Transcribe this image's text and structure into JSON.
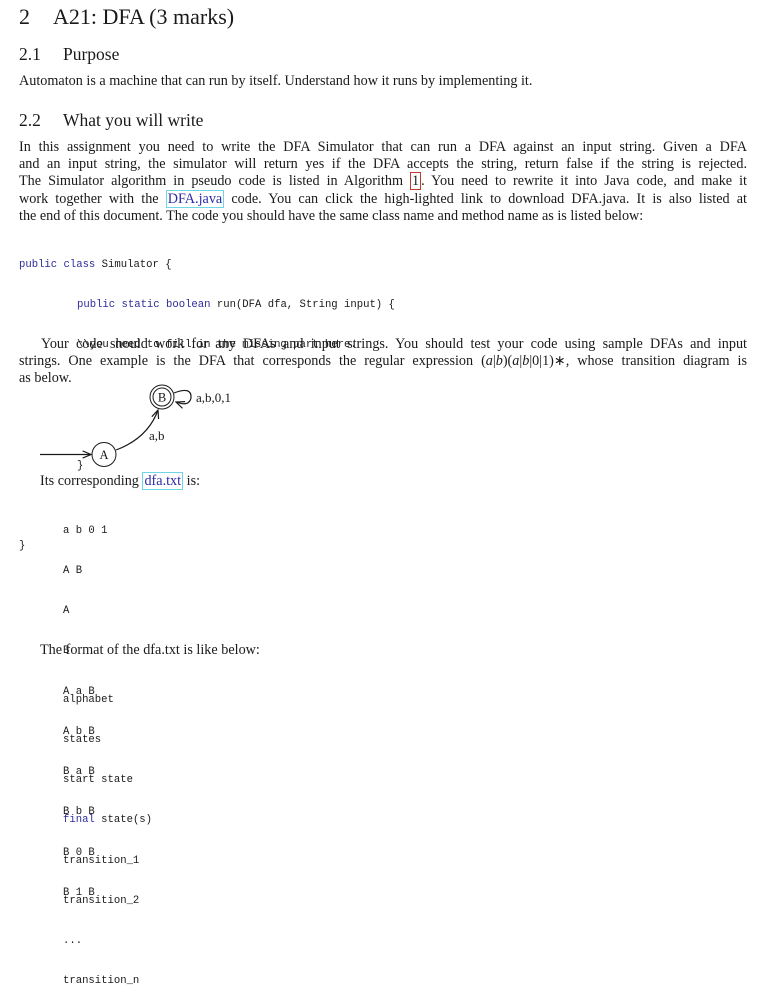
{
  "section": {
    "number": "2",
    "title": "A21: DFA (3 marks)"
  },
  "subsections": [
    {
      "number": "2.1",
      "title": "Purpose",
      "text": "Automaton is a machine that can run by itself. Understand how it runs by implementing it."
    },
    {
      "number": "2.2",
      "title": "What you will write"
    }
  ],
  "intro_paragraph": {
    "line1": "In this assignment you need to write the DFA Simulator that can run a DFA against an input string. Given a DFA",
    "line2": "and an input string, the simulator will return yes if the DFA accepts the string, return false if the string is rejected.",
    "line3_before": "The Simulator algorithm in pseudo code is listed in Algorithm ",
    "algorithm_ref": "1",
    "line3_after": ". You need to rewrite it into Java code, and make it",
    "line4_before": "work together with the ",
    "dfa_java_link": "DFA.java",
    "line4_after": " code. You can click the high-lighted link to download DFA.java. It is also listed at",
    "line5": "the end of this document. The code you should have the same class name and method name as is listed below:"
  },
  "code_listing": {
    "line1_kw": "public class",
    "line1_rest": " Simulator {",
    "line2_kw": "public static boolean",
    "line2_rest": " run(DFA dfa, String input) {",
    "line3": "\\\\you need to fill in the missing part here.",
    "line4": "}",
    "line5": "}"
  },
  "example_paragraph": {
    "line1": "Your code should work for any DFAs and input strings. You should test your code using sample DFAs and input",
    "line2_before": "strings. One example is the DFA that corresponds the regular expression (",
    "regex_parts": [
      "a",
      "|",
      "b",
      ")(",
      "a",
      "|",
      "b",
      "|0|1)∗, whose transition diagram is"
    ],
    "line3": "as below."
  },
  "diagram": {
    "states": [
      {
        "name": "A",
        "start": true,
        "final": false
      },
      {
        "name": "B",
        "start": false,
        "final": true
      }
    ],
    "transitions": [
      {
        "from": "A",
        "to": "B",
        "label": "a,b"
      },
      {
        "from": "B",
        "to": "B",
        "label": "a,b,0,1"
      }
    ]
  },
  "dfa_txt_intro": {
    "before": "Its corresponding ",
    "link": "dfa.txt",
    "after": " is:"
  },
  "dfa_txt_lines": [
    "a b 0 1",
    "A B",
    "A",
    "B",
    "A a B",
    "A b B",
    "B a B",
    "B b B",
    "B 0 B",
    "B 1 B"
  ],
  "format_intro": "The format of the dfa.txt is like below:",
  "format_lines": [
    {
      "kw": "",
      "text": "alphabet"
    },
    {
      "kw": "",
      "text": "states"
    },
    {
      "kw": "",
      "text": "start state"
    },
    {
      "kw": "final",
      "text": " state(s)"
    },
    {
      "kw": "",
      "text": "transition_1"
    },
    {
      "kw": "",
      "text": "transition_2"
    },
    {
      "kw": "",
      "text": "..."
    },
    {
      "kw": "",
      "text": "transition_n"
    }
  ],
  "colors": {
    "link_border": "#6fd6e6",
    "link_text": "#2a2aa8",
    "ref_border": "#c0392b",
    "keyword": "#2d2d9a"
  }
}
